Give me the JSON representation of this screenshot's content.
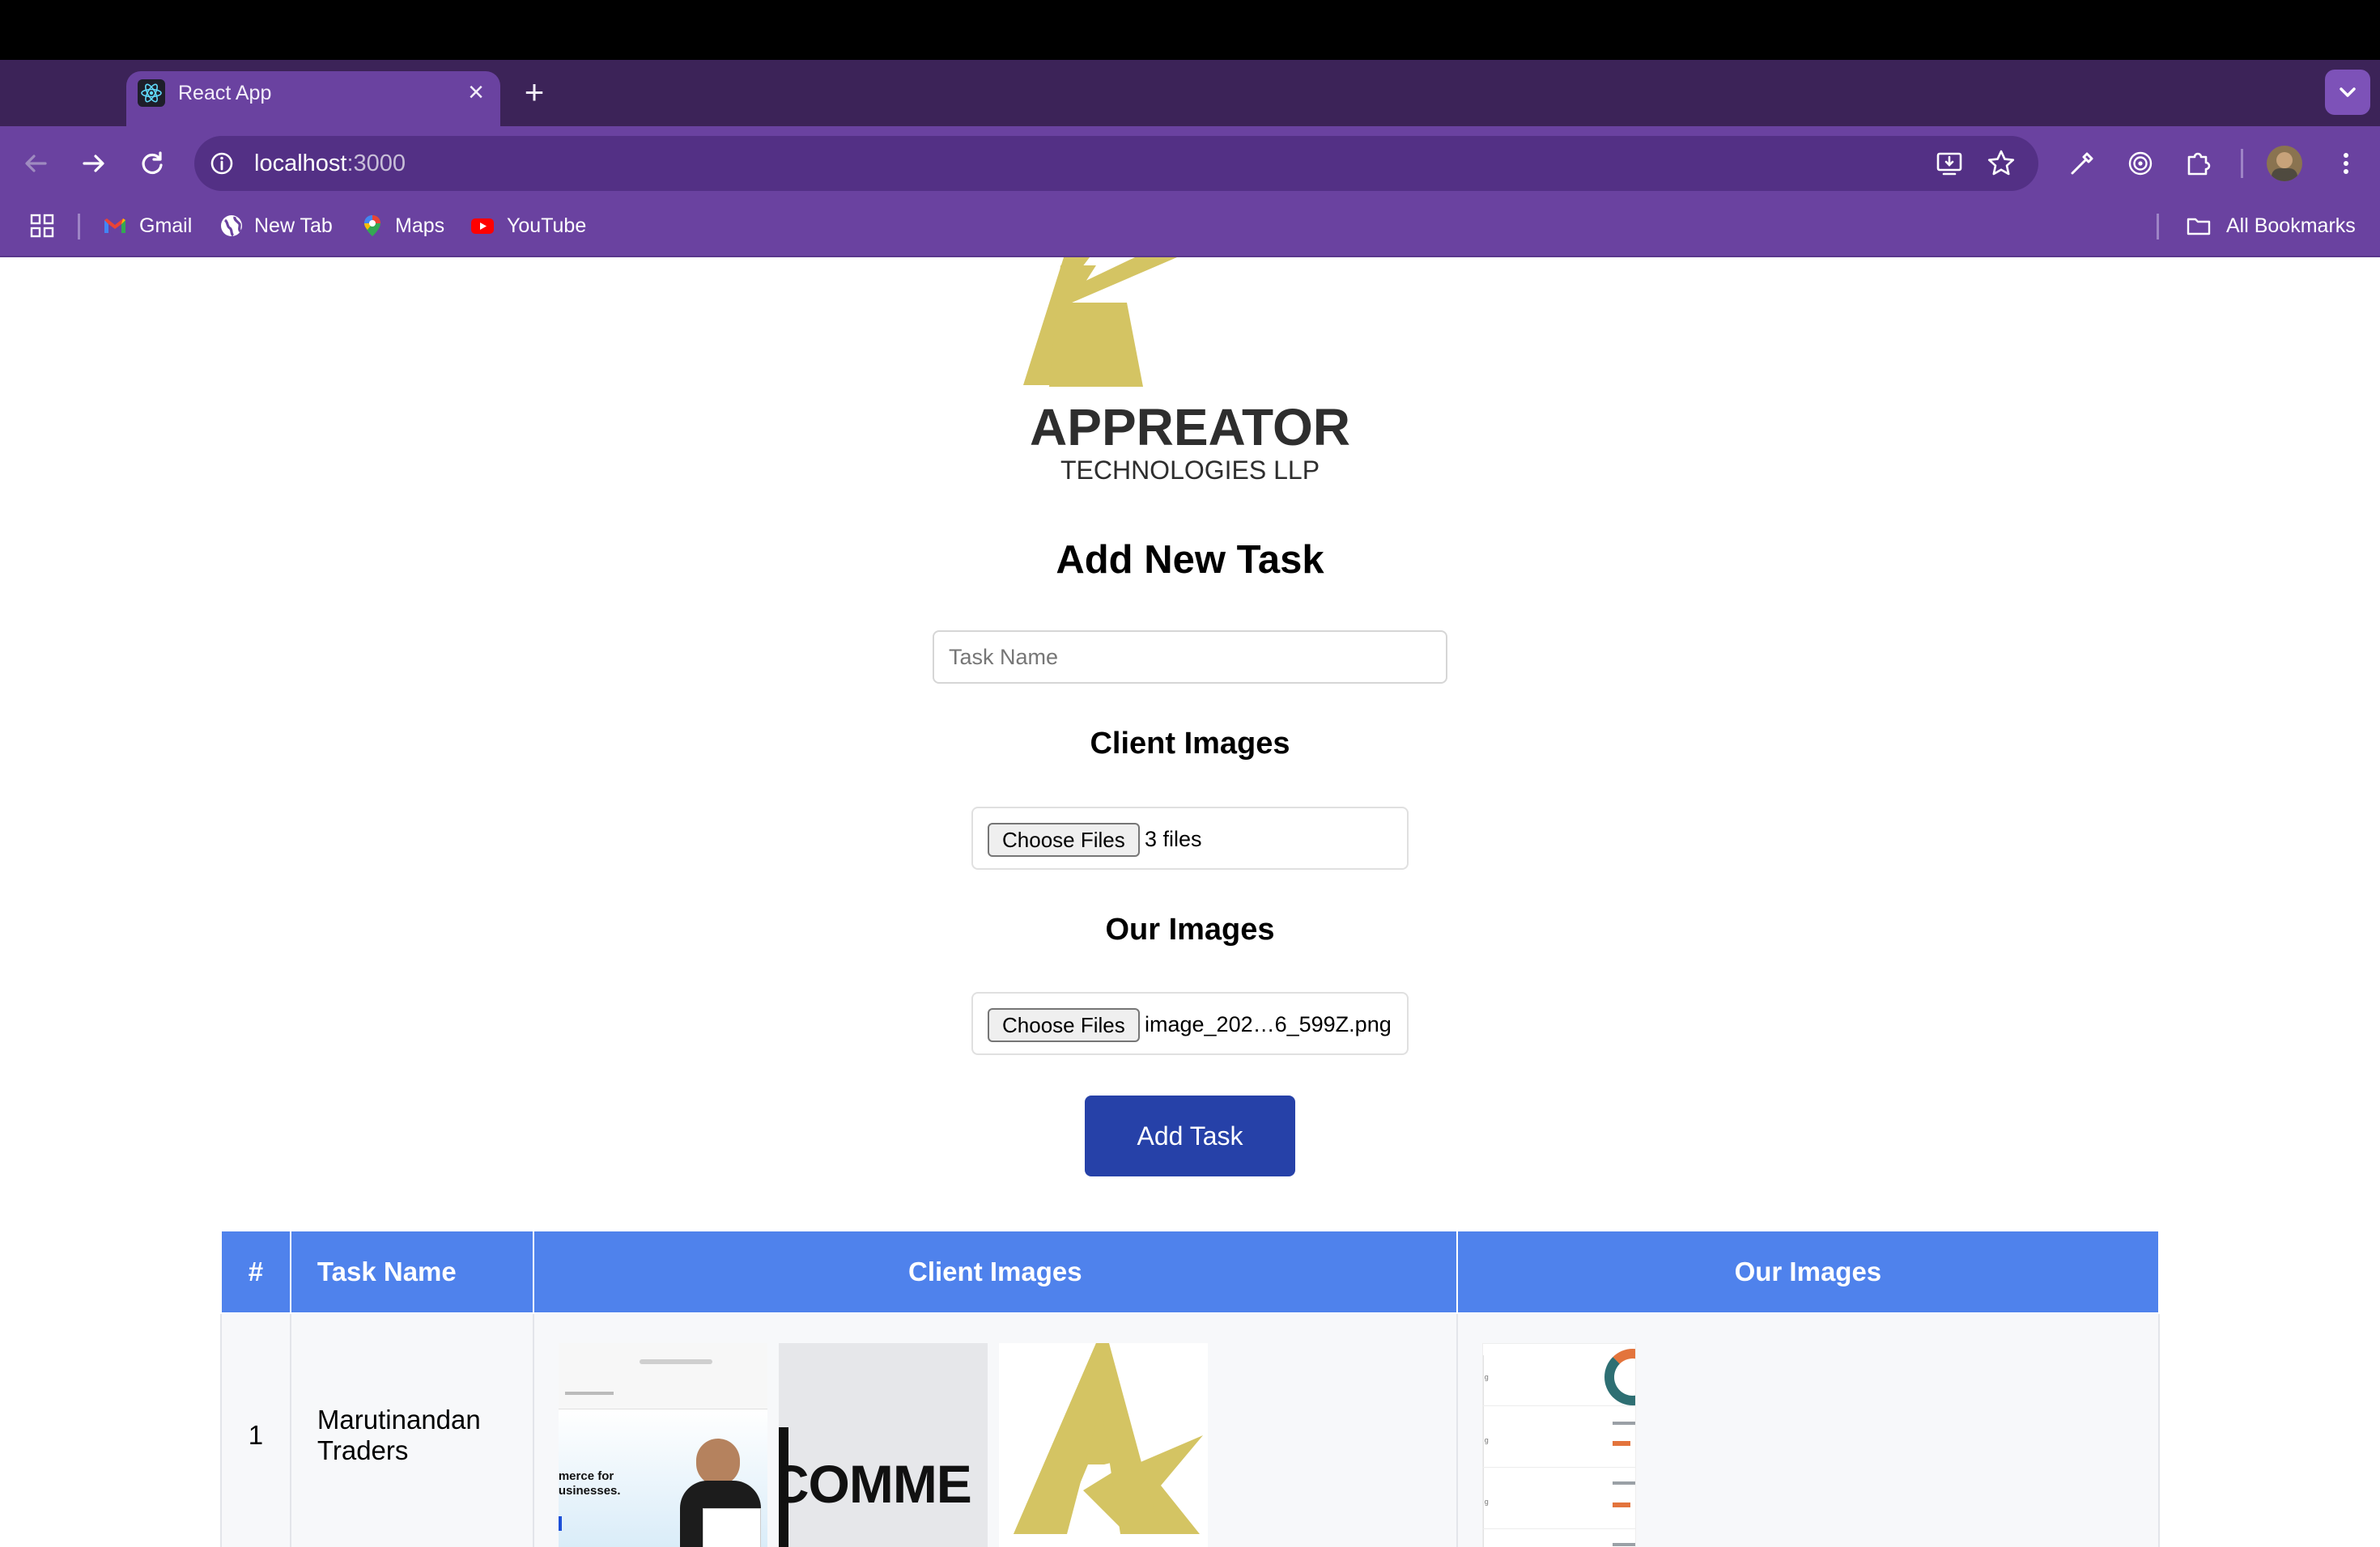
{
  "browser": {
    "tab_title": "React App",
    "url_host": "localhost",
    "url_port": ":3000",
    "bookmarks": [
      {
        "label": "Gmail",
        "icon": "gmail-icon"
      },
      {
        "label": "New Tab",
        "icon": "globe-icon"
      },
      {
        "label": "Maps",
        "icon": "maps-icon"
      },
      {
        "label": "YouTube",
        "icon": "youtube-icon"
      }
    ],
    "all_bookmarks_label": "All Bookmarks",
    "colors": {
      "frame": "#3c2358",
      "toolbar": "#6a42a0",
      "omnibox": "#533085"
    }
  },
  "logo": {
    "brand": "APPREATOR",
    "tagline": "TECHNOLOGIES LLP",
    "color": "#d4c463"
  },
  "form": {
    "title": "Add New Task",
    "task_name_placeholder": "Task Name",
    "client_images": {
      "heading": "Client Images",
      "button_label": "Choose Files",
      "selected": "3 files"
    },
    "our_images": {
      "heading": "Our Images",
      "button_label": "Choose Files",
      "selected": "image_202…6_599Z.png"
    },
    "submit_label": "Add Task",
    "submit_color": "#2641a8"
  },
  "table": {
    "headers": [
      "#",
      "Task Name",
      "Client Images",
      "Our Images"
    ],
    "header_color": "#4f82ec",
    "rows": [
      {
        "num": "1",
        "name_line1": "Marutinandan",
        "name_line2": "Traders",
        "client_thumb_texts": [
          "merce for",
          "usinesses.",
          "COMME"
        ]
      }
    ]
  }
}
